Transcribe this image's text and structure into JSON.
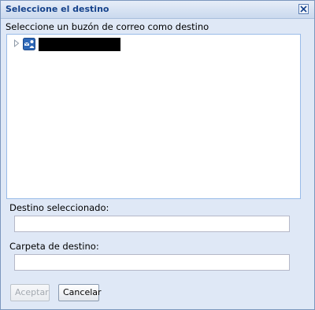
{
  "dialog": {
    "title": "Seleccione el destino",
    "close_icon": "close-icon"
  },
  "prompt": "Seleccione un buzón de correo como destino",
  "tree": {
    "nodes": [
      {
        "icon": "mailbox-icon",
        "label": "",
        "redacted": true,
        "expanded": false
      }
    ]
  },
  "fields": {
    "destination_label": "Destino seleccionado:",
    "destination_value": "",
    "folder_label": "Carpeta de destino:",
    "folder_value": ""
  },
  "buttons": {
    "accept": "Aceptar",
    "cancel": "Cancelar"
  },
  "colors": {
    "title_text": "#15428b",
    "panel_background": "#dfe8f6",
    "border": "#99bbe8"
  }
}
